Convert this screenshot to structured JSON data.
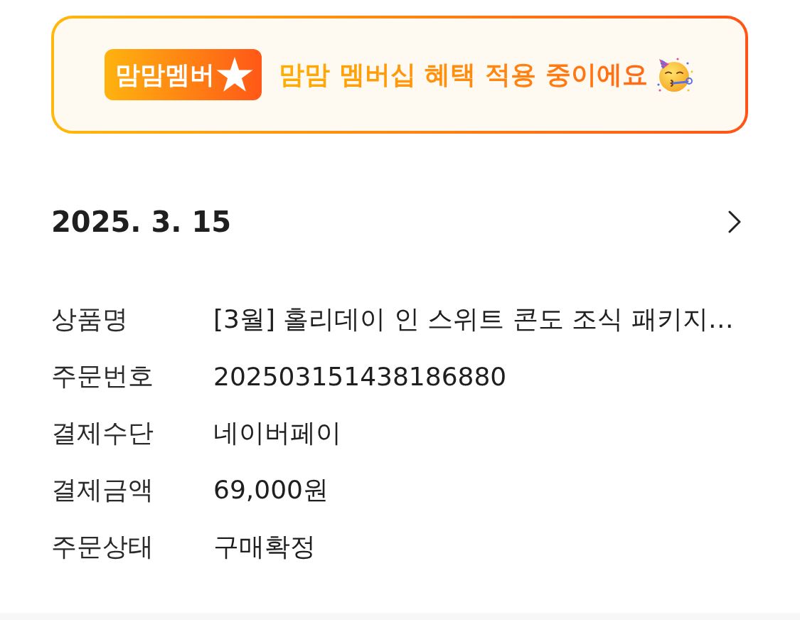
{
  "banner": {
    "badge": "맘맘멤버",
    "message": "맘맘 멤버십 혜택 적용 중이에요"
  },
  "order": {
    "date": "2025. 3. 15",
    "details": [
      {
        "label": "상품명",
        "value": "[3월] 홀리데이 인 스위트 콘도 조식 패키지…"
      },
      {
        "label": "주문번호",
        "value": "202503151438186880"
      },
      {
        "label": "결제수단",
        "value": "네이버페이"
      },
      {
        "label": "결제금액",
        "value": "69,000원"
      },
      {
        "label": "주문상태",
        "value": "구매확정"
      }
    ]
  }
}
